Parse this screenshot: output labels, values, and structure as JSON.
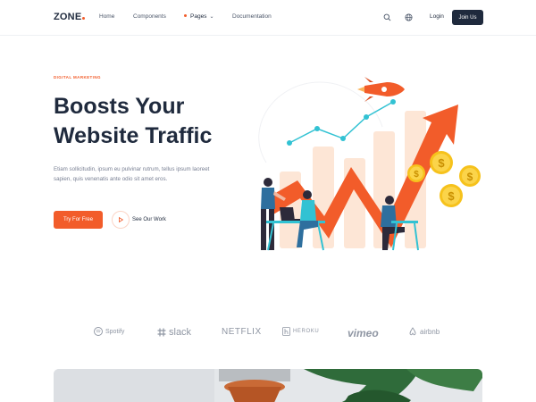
{
  "brand": {
    "name": "ZONE",
    "accent_color": "#f25c2a",
    "dark_color": "#1f2a3d"
  },
  "nav": {
    "links": [
      {
        "label": "Home"
      },
      {
        "label": "Components"
      },
      {
        "label": "Pages",
        "active": true,
        "has_dropdown": true
      },
      {
        "label": "Documentation"
      }
    ],
    "search_icon": "search-icon",
    "globe_icon": "globe-icon",
    "login_label": "Login",
    "join_label": "Join Us"
  },
  "hero": {
    "eyebrow": "DIGITAL MARKETING",
    "title_line1": "Boosts Your",
    "title_line2": "Website Traffic",
    "paragraph": "Etiam sollicitudin, ipsum eu pulvinar rutrum, tellus ipsum laoreet sapien, quis venenatis ante odio sit amet eros.",
    "primary_cta": "Try For Free",
    "secondary_cta": "See Our Work"
  },
  "logos": [
    {
      "name": "Spotify"
    },
    {
      "name": "slack"
    },
    {
      "name": "NETFLIX"
    },
    {
      "name": "HEROKU"
    },
    {
      "name": "vimeo"
    },
    {
      "name": "airbnb"
    }
  ]
}
